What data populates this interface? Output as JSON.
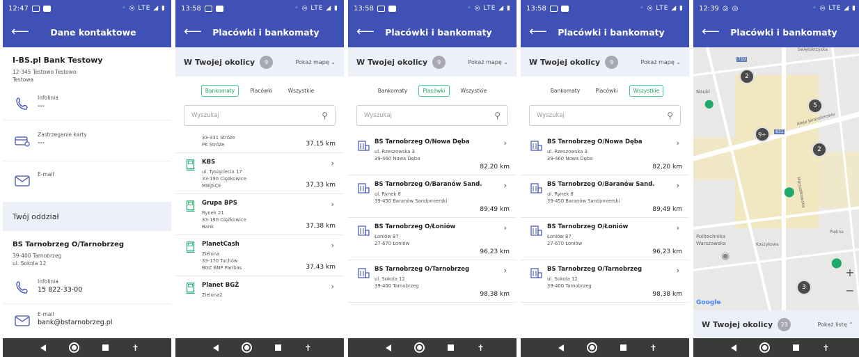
{
  "statusbars": [
    {
      "time": "12:47",
      "signal": "◦ ◎ LTE ◢ ▮"
    },
    {
      "time": "13:58",
      "signal": "◦ ◎ LTE ◢ ▮"
    },
    {
      "time": "13:58",
      "signal": "◦ ◎ LTE ◢ ▮"
    },
    {
      "time": "13:58",
      "signal": "◦ ◎ LTE ◢ ▮"
    },
    {
      "time": "12:39",
      "signal": "◦ ◎ LTE ◢ ▮"
    }
  ],
  "screen1": {
    "title": "Dane kontaktowe",
    "bank_name": "I-BS.pl Bank Testowy",
    "address1": "12-345 Testowo Testowo",
    "address2": "Testowa",
    "hotline_label": "Infolinia",
    "hotline_value": "---",
    "block_label": "Zastrzeganie karty",
    "block_value": "---",
    "email_label": "E-mail",
    "branch_header": "Twój oddział",
    "branch_name": "BS Tarnobrzeg O/Tarnobrzeg",
    "branch_addr1": "39-400 Tarnobrzeg",
    "branch_addr2": "ul. Sokola 12",
    "branch_hotline_label": "Infolinia",
    "branch_hotline_value": "15 822-33-00",
    "branch_email_label": "E-mail",
    "branch_email_value": "bank@bstarnobrzeg.pl"
  },
  "common": {
    "list_title": "Placówki i bankomaty",
    "near_title": "W Twojej okolicy",
    "near_count": "9",
    "show_map": "Pokaż mapę",
    "tab_atm": "Bankomaty",
    "tab_branch": "Placówki",
    "tab_all": "Wszystkie",
    "search_placeholder": "Wyszukaj"
  },
  "atm_list": {
    "partial": {
      "line1": "33-331 Stróże",
      "line2": "PK Stróże",
      "dist": "37,15 km"
    },
    "items": [
      {
        "name": "KBS",
        "line1": "ul. Tysiąclecia 17",
        "line2": "33-190 Ciężkowice",
        "line3": "MIEJSCE",
        "dist": "37,33 km"
      },
      {
        "name": "Grupa BPS",
        "line1": "Rynek 21",
        "line2": "33-190 Ciężkowice",
        "line3": "Bank",
        "dist": "37,38 km"
      },
      {
        "name": "PlanetCash",
        "line1": "Zielona",
        "line2": "33-170 Tuchów",
        "line3": "BGŻ BNP Paribas",
        "dist": "37,43 km"
      },
      {
        "name": "Planet BGŻ",
        "line1": "Zielona2",
        "line2": "",
        "line3": "",
        "dist": ""
      }
    ]
  },
  "branch_list": {
    "items": [
      {
        "name": "BS Tarnobrzeg O/Nowa Dęba",
        "line1": "ul. Rzeszowska 3",
        "line2": "39-460 Nowa Dęba",
        "dist": "82,20 km"
      },
      {
        "name": "BS Tarnobrzeg O/Baranów Sand.",
        "line1": "ul. Rynek 8",
        "line2": "39-450 Baranów Sandomierski",
        "dist": "89,49 km"
      },
      {
        "name": "BS Tarnobrzeg O/Łoniów",
        "line1": "Łoniów 87",
        "line2": "27-670 Łoniów",
        "dist": "96,23 km"
      },
      {
        "name": "BS Tarnobrzeg O/Tarnobrzeg",
        "line1": "ul. Sokola 12",
        "line2": "39-400 Tarnobrzeg",
        "dist": "98,38 km"
      }
    ]
  },
  "map": {
    "clusters": [
      "2",
      "5",
      "9+",
      "2",
      "3"
    ],
    "labels": [
      "Nauki",
      "Politechnika",
      "Warszawska",
      "Koszykowa",
      "Piękna",
      "Marszałkowska",
      "Aleje Jerozolimskie",
      "Świętokrzyska"
    ],
    "road_numbers": [
      "719",
      "631"
    ],
    "zoom_in": "+",
    "zoom_out": "−",
    "google": "Google",
    "near_count": "23",
    "show_list": "Pokaż listę"
  }
}
